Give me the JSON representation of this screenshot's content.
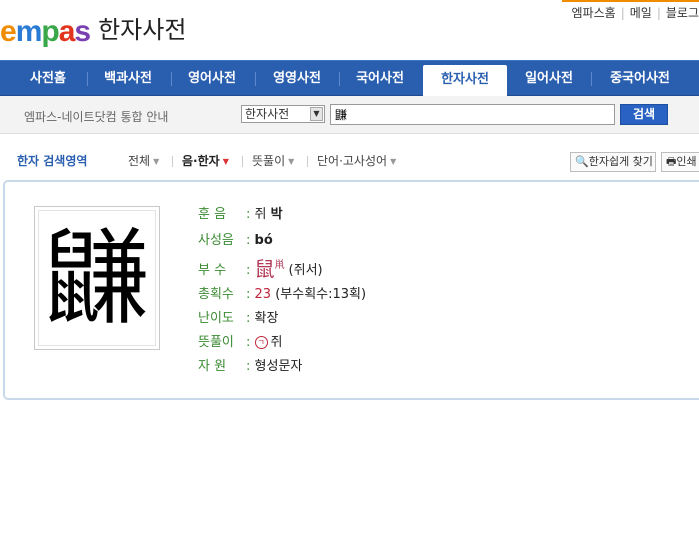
{
  "header": {
    "brand": "empas",
    "title": "한자사전",
    "top_links": [
      "엠파스홈",
      "메일",
      "블로그"
    ]
  },
  "nav": {
    "items": [
      "사전홈",
      "백과사전",
      "영어사전",
      "영영사전",
      "국어사전",
      "한자사전",
      "일어사전",
      "중국어사전"
    ],
    "active": "한자사전"
  },
  "search": {
    "notice": "엠파스-네이트닷컴 통합 안내",
    "dictionary_select": "한자사전",
    "query": "鼸",
    "button": "검색"
  },
  "filters": {
    "label": "한자 검색영역",
    "items": [
      "전체",
      "음·한자",
      "뜻풀이",
      "단어·고사성어"
    ],
    "active": "음·한자"
  },
  "tools": {
    "easy_find": "한자쉽게 찾기",
    "print": "인쇄"
  },
  "entry": {
    "character": "鼸",
    "fields": {
      "hun_eum": {
        "label": "훈 음",
        "value_pre": "쥐 ",
        "value_bold": "박"
      },
      "pinyin": {
        "label": "사성음",
        "value": "bó"
      },
      "radical": {
        "label": "부 수",
        "radical": "鼠",
        "radical_small": "鼡",
        "value": "(쥐서)"
      },
      "strokes": {
        "label": "총획수",
        "count": "23",
        "value": "(부수획수:13획)"
      },
      "difficulty": {
        "label": "난이도",
        "value": "확장"
      },
      "meaning": {
        "label": "뜻풀이",
        "marker": "ㄱ",
        "value": "쥐"
      },
      "origin": {
        "label": "자 원",
        "value": "형성문자"
      }
    }
  },
  "colors": {
    "nav_bg": "#2a5fb0",
    "label_green": "#3c8b33",
    "accent_red": "#c0243a"
  }
}
